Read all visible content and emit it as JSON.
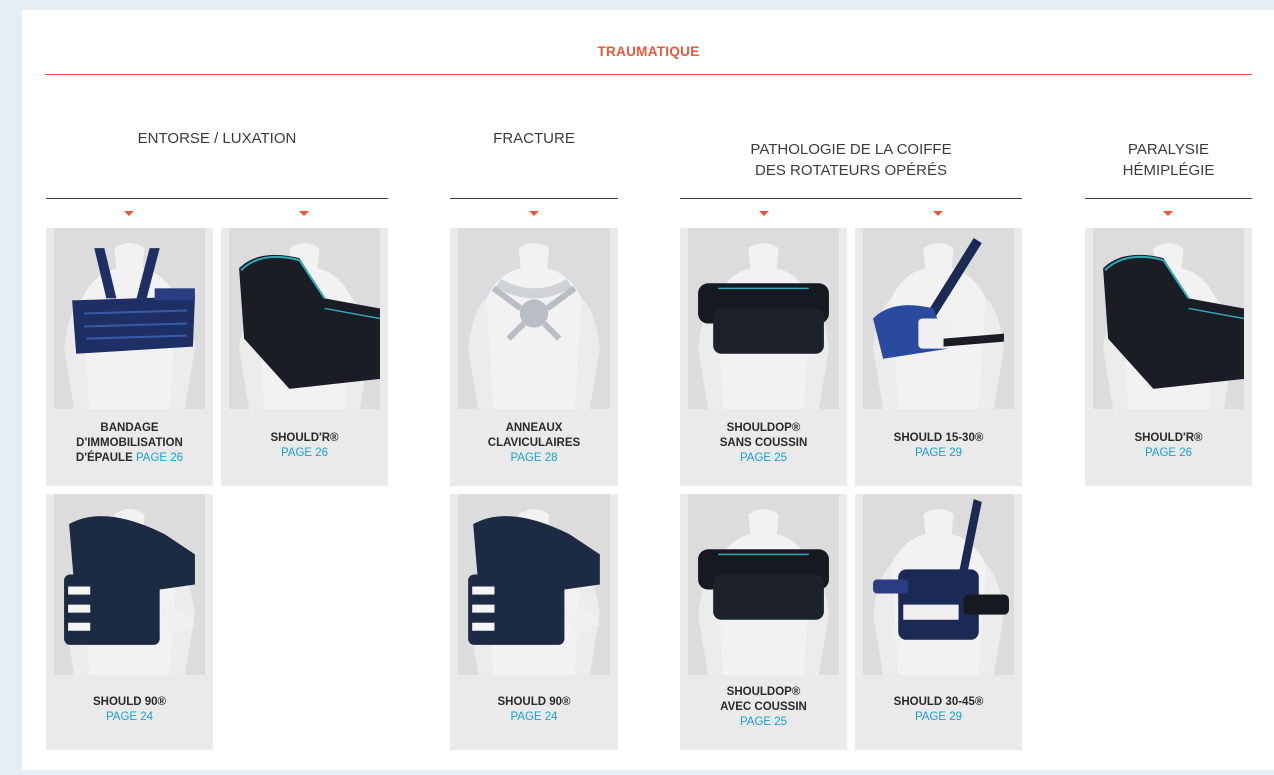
{
  "section_title": "TRAUMATIQUE",
  "categories": [
    {
      "title": "ENTORSE / LUXATION"
    },
    {
      "title": "FRACTURE"
    },
    {
      "title": "PATHOLOGIE DE LA COIFFE\nDES ROTATEURS OPÉRÉS"
    },
    {
      "title": "PARALYSIE\nHÉMIPLÉGIE"
    }
  ],
  "products": [
    {
      "name_lines": [
        "BANDAGE",
        "D'IMMOBILISATION"
      ],
      "name_last": "D'ÉPAULE",
      "page": "PAGE 26",
      "photo": "sling-bandage"
    },
    {
      "name": "SHOULD'R®",
      "page": "PAGE 26",
      "photo": "shoulder-brace-black"
    },
    {
      "name": "SHOULD 90®",
      "page": "PAGE 24",
      "photo": "should-90-brace"
    },
    {
      "name_lines": [
        "ANNEAUX",
        "CLAVICULAIRES"
      ],
      "page": "PAGE 28",
      "photo": "clavicle-rings"
    },
    {
      "name": "SHOULD 90®",
      "page": "PAGE 24",
      "photo": "should-90-brace"
    },
    {
      "name_lines": [
        "SHOULDOP®",
        "SANS COUSSIN"
      ],
      "page": "PAGE 25",
      "photo": "shouldop-no-cushion"
    },
    {
      "name": "SHOULD 15-30®",
      "page": "PAGE 29",
      "photo": "should-15-30-sling"
    },
    {
      "name_lines": [
        "SHOULDOP®",
        "AVEC COUSSIN"
      ],
      "page": "PAGE 25",
      "photo": "shouldop-cushion"
    },
    {
      "name": "SHOULD 30-45®",
      "page": "PAGE 29",
      "photo": "should-30-45-sling"
    },
    {
      "name": "SHOULD'R®",
      "page": "PAGE 26",
      "photo": "shoulder-brace-black"
    }
  ],
  "colors": {
    "accent": "#e8573a",
    "link": "#1b9fd3",
    "card_bg": "#eaeaea",
    "frame": "#e3eef6"
  }
}
